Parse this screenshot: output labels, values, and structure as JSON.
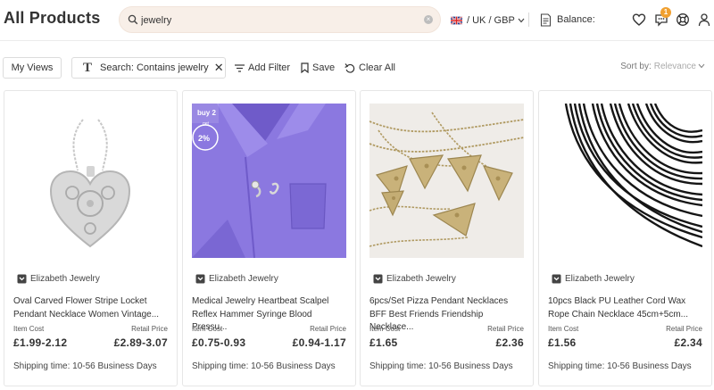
{
  "header": {
    "title": "All Products",
    "search_value": "jewelry",
    "region": "/ UK / GBP",
    "balance_label": "Balance:",
    "notification_count": "1"
  },
  "toolbar": {
    "my_views": "My Views",
    "filter_chip": "Search: Contains jewelry",
    "add_filter": "Add Filter",
    "save": "Save",
    "clear_all": "Clear All",
    "sort_label": "Sort by:",
    "sort_value": "Relevance"
  },
  "products": [
    {
      "seller": "Elizabeth Jewelry",
      "name": "Oval Carved Flower Stripe Locket Pendant Necklace Women Vintage...",
      "item_cost_label": "Item Cost",
      "item_cost": "£1.99-2.12",
      "retail_label": "Retail Price",
      "retail_price": "£2.89-3.07",
      "shipping": "Shipping time: 10-56 Business Days"
    },
    {
      "seller": "Elizabeth Jewelry",
      "name": "Medical Jewelry Heartbeat Scalpel Reflex Hammer Syringe Blood Pressu...",
      "item_cost_label": "Item Cost",
      "item_cost": "£0.75-0.93",
      "retail_label": "Retail Price",
      "retail_price": "£0.94-1.17",
      "shipping": "Shipping time: 10-56 Business Days",
      "image_text_1": "buy 2",
      "image_text_2": "get",
      "image_text_3": "2%"
    },
    {
      "seller": "Elizabeth Jewelry",
      "name": "6pcs/Set Pizza Pendant Necklaces BFF Best Friends Friendship Necklace...",
      "item_cost_label": "Item Cost",
      "item_cost": "£1.65",
      "retail_label": "Retail Price",
      "retail_price": "£2.36",
      "shipping": "Shipping time: 10-56 Business Days"
    },
    {
      "seller": "Elizabeth Jewelry",
      "name": "10pcs Black PU Leather Cord Wax Rope Chain Necklace 45cm+5cm...",
      "item_cost_label": "Item Cost",
      "item_cost": "£1.56",
      "retail_label": "Retail Price",
      "retail_price": "£2.34",
      "shipping": "Shipping time: 10-56 Business Days"
    }
  ],
  "icons": {
    "search": "search-icon",
    "clear": "clear-icon",
    "flag": "uk-flag-icon",
    "balance": "receipt-icon",
    "wishlist": "heart-icon",
    "messages": "chat-icon",
    "help": "lifebuoy-icon",
    "account": "user-icon"
  },
  "colors": {
    "search_bg": "#f8efe8",
    "badge": "#f0a030",
    "scrub_purple": "#8b78e0"
  }
}
